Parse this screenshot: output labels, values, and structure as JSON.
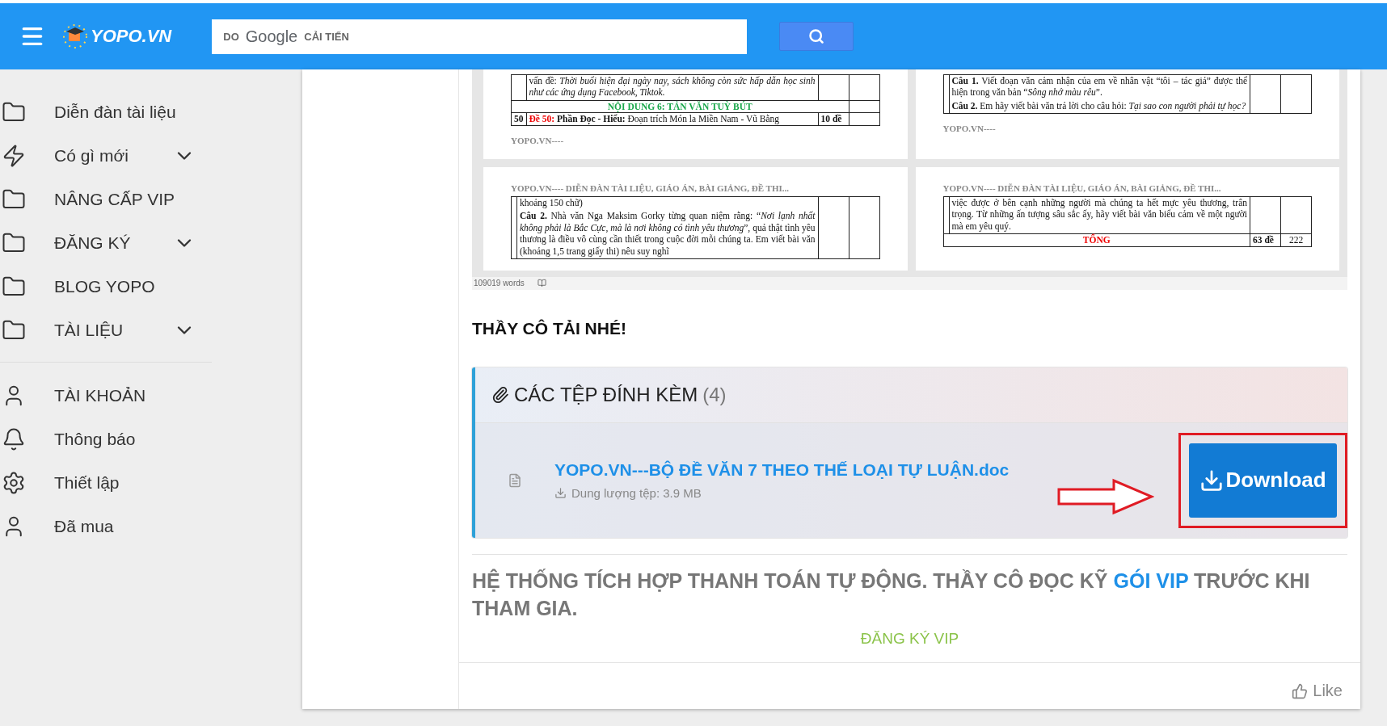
{
  "header": {
    "logo": "YOPO.VN",
    "search": {
      "prefix": "DO",
      "brand": "Google",
      "suffix": "CẢI TIẾN"
    }
  },
  "sidebar": {
    "groups": [
      [
        {
          "label": "Diễn đàn tài liệu",
          "expandable": false
        },
        {
          "label": "Có gì mới",
          "expandable": true
        },
        {
          "label": "NÂNG CẤP VIP",
          "expandable": false
        },
        {
          "label": "ĐĂNG KÝ",
          "expandable": true
        },
        {
          "label": "BLOG YOPO",
          "expandable": false
        },
        {
          "label": "TÀI LIỆU",
          "expandable": true
        }
      ],
      [
        {
          "label": "TÀI KHOẢN",
          "expandable": false
        },
        {
          "label": "Thông báo",
          "expandable": false
        },
        {
          "label": "Thiết lập",
          "expandable": false
        },
        {
          "label": "Đã mua",
          "expandable": false
        }
      ]
    ]
  },
  "document_preview": {
    "pages": [
      {
        "rows": [
          {
            "kind": "text",
            "paragraphs": [
              "vấn đề: *Thời buổi hiện đại ngày nay, sách không còn sức hấp dẫn học sinh như các ứng dụng Facebook, Tiktok.*"
            ]
          },
          {
            "kind": "section",
            "text": "NỘI DUNG 6: TẢN VĂN TUỲ BÚT"
          },
          {
            "kind": "item",
            "no": "50",
            "lead": "Đề 50:",
            "text": "**Phần Đọc - Hiểu:** Đoạn trích Món la Miền Nam - Vũ Bằng",
            "count": "10 đề"
          }
        ],
        "footer": "YOPO.VN----"
      },
      {
        "rows": [
          {
            "kind": "text",
            "paragraphs": [
              "**Câu 1.** Viết đoạn văn cảm nhận của em về nhân vật “tôi – tác giả” được thể hiện trong văn bản “*Sông nhớ màu rêu*”.",
              "**Câu 2.** Em hãy viết bài văn trả lời cho câu hỏi: *Tại sao con người phải tự học?*"
            ]
          }
        ],
        "footer": "YOPO.VN----"
      },
      {
        "header": "YOPO.VN---- DIỄN ĐÀN TÀI LIỆU, GIÁO ÁN, BÀI GIẢNG, ĐỀ THI...",
        "rows": [
          {
            "kind": "text",
            "paragraphs": [
              "khoảng 150 chữ)",
              "**Câu 2.** Nhà văn Nga Maksim Gorky từng quan niệm rằng: “*Nơi lạnh nhất không phải là Bắc Cực, mà là nơi không có tình yêu thương*”, quả thật tình yêu thương là điều vô cùng cần thiết trong cuộc đời mỗi chúng ta. Em viết bài văn (khoảng 1,5 trang giấy thi) nêu suy nghĩ"
            ]
          }
        ]
      },
      {
        "header": "YOPO.VN---- DIỄN ĐÀN TÀI LIỆU, GIÁO ÁN, BÀI GIẢNG, ĐỀ THI...",
        "rows": [
          {
            "kind": "text",
            "paragraphs": [
              "việc được ở bên cạnh những người mà chúng ta hết mực yêu thương, trân trọng. Từ những ấn tượng sâu sắc ấy, hãy viết bài văn biểu cảm về một người mà em yêu quý."
            ]
          },
          {
            "kind": "total",
            "text": "TỔNG",
            "count": "63 đề",
            "col4": "222"
          }
        ]
      }
    ],
    "word_count": "109019 words"
  },
  "heading": "THẦY CÔ TẢI NHÉ!",
  "attachments": {
    "title": "CÁC TỆP ĐÍNH KÈM",
    "count": "(4)",
    "files": [
      {
        "name": "YOPO.VN---BỘ ĐỀ VĂN 7 THEO THẾ LOẠI TỰ LUẬN.doc",
        "size": "Dung lượng tệp: 3.9 MB",
        "button": "Download",
        "highlighted": true
      }
    ]
  },
  "notice": {
    "before": "HỆ THỐNG TÍCH HỢP THANH TOÁN TỰ ĐỘNG. THẦY CÔ ĐỌC KỸ",
    "link": "GÓI VIP",
    "after": "TRƯỚC KHI THAM GIA."
  },
  "vip_link": "ĐĂNG KÝ VIP",
  "like": "Like"
}
